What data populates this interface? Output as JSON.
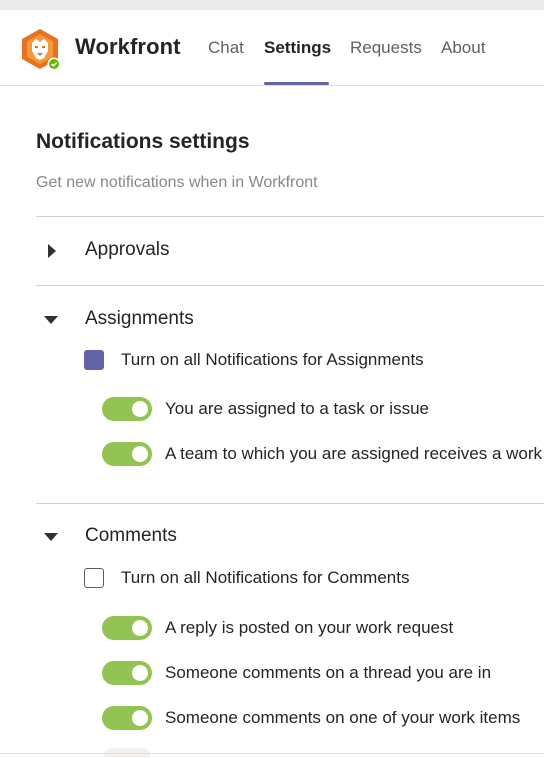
{
  "app": {
    "name": "Workfront",
    "status": "online"
  },
  "tabs": [
    {
      "label": "Chat",
      "active": false
    },
    {
      "label": "Settings",
      "active": true
    },
    {
      "label": "Requests",
      "active": false
    },
    {
      "label": "About",
      "active": false
    }
  ],
  "page": {
    "title": "Notifications settings",
    "subtitle": "Get new notifications when in Workfront"
  },
  "sections": [
    {
      "label": "Approvals",
      "expanded": false
    },
    {
      "label": "Assignments",
      "expanded": true,
      "master": {
        "label": "Turn on all Notifications for Assignments",
        "checked": true
      },
      "toggles": [
        {
          "label": "You are assigned to a task or issue",
          "on": true
        },
        {
          "label": "A team to which you are assigned receives a work",
          "on": true
        }
      ]
    },
    {
      "label": "Comments",
      "expanded": true,
      "master": {
        "label": "Turn on all Notifications for Comments",
        "checked": false
      },
      "toggles": [
        {
          "label": "A reply is posted on your work request",
          "on": true
        },
        {
          "label": "Someone comments on a thread you are in",
          "on": true
        },
        {
          "label": "Someone comments on one of your work items",
          "on": true
        }
      ]
    }
  ],
  "colors": {
    "accent": "#6264a7",
    "toggle_on": "#92c353",
    "logo_orange": "#e8731e",
    "status_green": "#6bb700"
  }
}
